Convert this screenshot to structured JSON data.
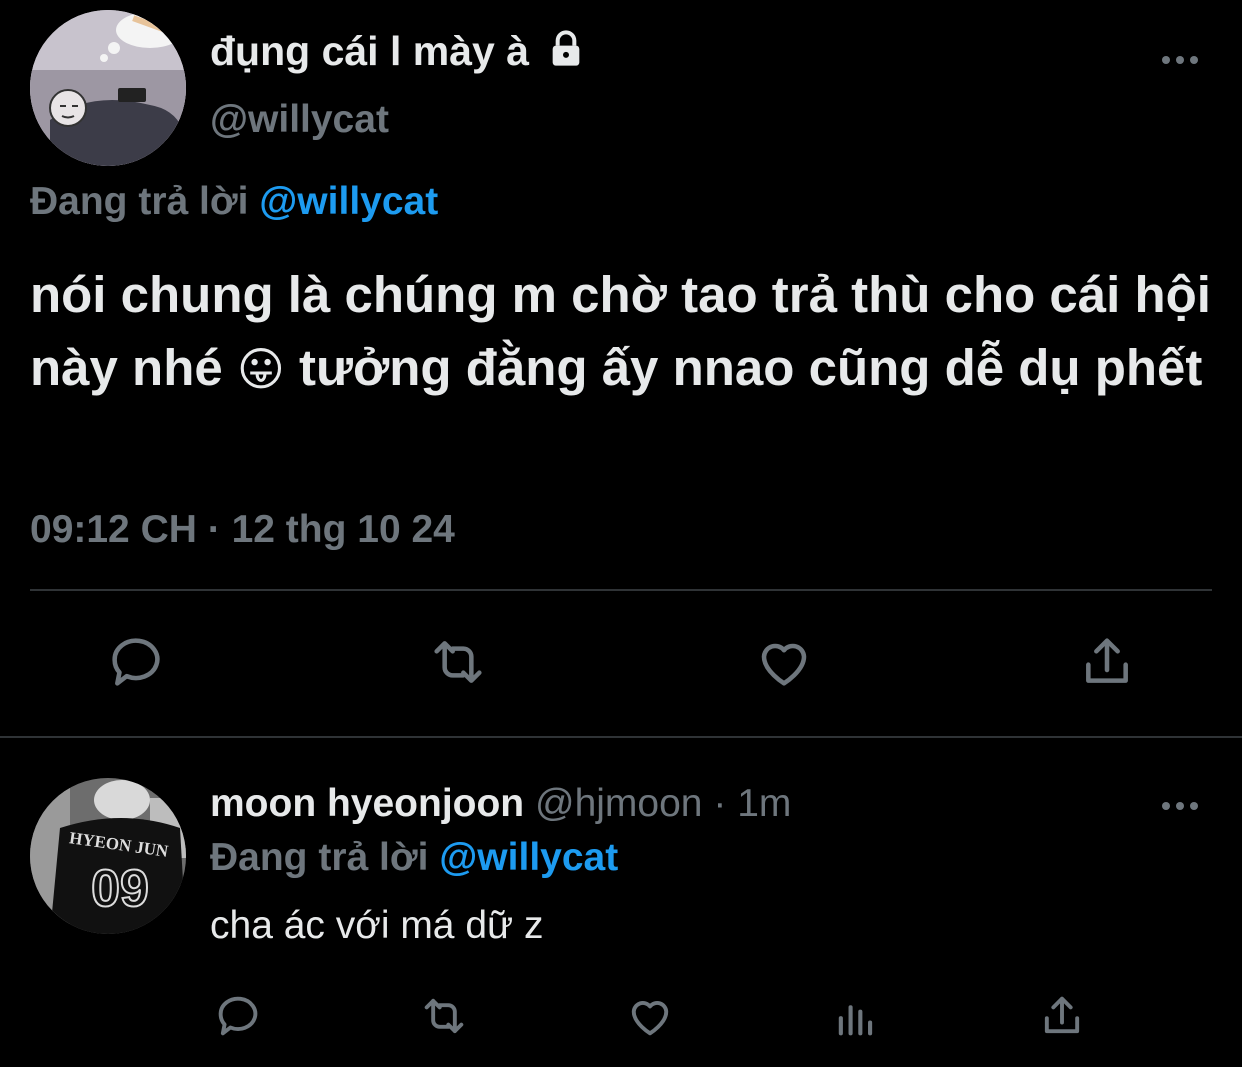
{
  "main_tweet": {
    "display_name": "đụng cái l mày à",
    "lock_icon": "lock-icon",
    "handle": "@willycat",
    "replying_prefix": "Đang trả lời",
    "replying_to": "@willycat",
    "text_part1": "nói chung là chúng m chờ tao trả thù cho cái hội này nhé",
    "emoji": "😛",
    "text_part2": "tưởng đằng ấy nnao cũng dễ dụ phết",
    "timestamp": "09:12 CH · 12 thg 10 24",
    "actions": [
      "reply-icon",
      "retweet-icon",
      "like-icon",
      "share-icon"
    ]
  },
  "reply_tweet": {
    "display_name": "moon hyeonjoon",
    "handle": "@hjmoon",
    "separator": "·",
    "time": "1m",
    "replying_prefix": "Đang trả lời",
    "replying_to": "@willycat",
    "text": "cha ác với má dữ z",
    "avatar_text_top": "HYEON JUN",
    "avatar_text_number": "09",
    "actions": [
      "reply-icon",
      "retweet-icon",
      "like-icon",
      "analytics-icon",
      "share-icon"
    ]
  },
  "colors": {
    "background": "#000000",
    "text": "#e7e9ea",
    "secondary": "#6e767d",
    "accent": "#1d9bf0",
    "divider": "#2f3336"
  }
}
